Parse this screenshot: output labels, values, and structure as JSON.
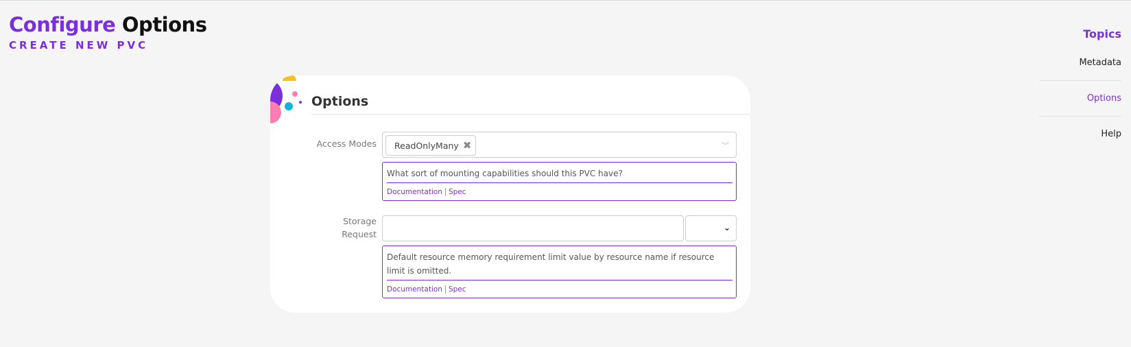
{
  "header": {
    "title_accent": "Configure",
    "title_rest": "Options",
    "subtitle": "CREATE NEW PVC"
  },
  "topics": {
    "title": "Topics",
    "items": [
      {
        "label": "Metadata",
        "active": false
      },
      {
        "label": "Options",
        "active": true
      },
      {
        "label": "Help",
        "active": false
      }
    ]
  },
  "card": {
    "title": "Options",
    "access_modes": {
      "label": "Access Modes",
      "selected_chip": "ReadOnlyMany",
      "remove_icon": "close-x-icon",
      "caret_icon": "chevron-down-icon",
      "help_text": "What sort of mounting capabilities should this PVC have?",
      "doc_link": "Documentation",
      "spec_link": "Spec"
    },
    "storage_request": {
      "label": "Storage Request",
      "value": "",
      "unit_value": "",
      "help_text": "Default resource memory requirement limit value by resource name if resource limit is omitted.",
      "doc_link": "Documentation",
      "spec_link": "Spec"
    }
  },
  "colors": {
    "accent": "#7b2fd9",
    "background": "#f5f5f6",
    "decor_purple": "#7b2fd9",
    "decor_yellow": "#f7c21c",
    "decor_pink": "#ff7fb0",
    "decor_cyan": "#12b5d8"
  }
}
